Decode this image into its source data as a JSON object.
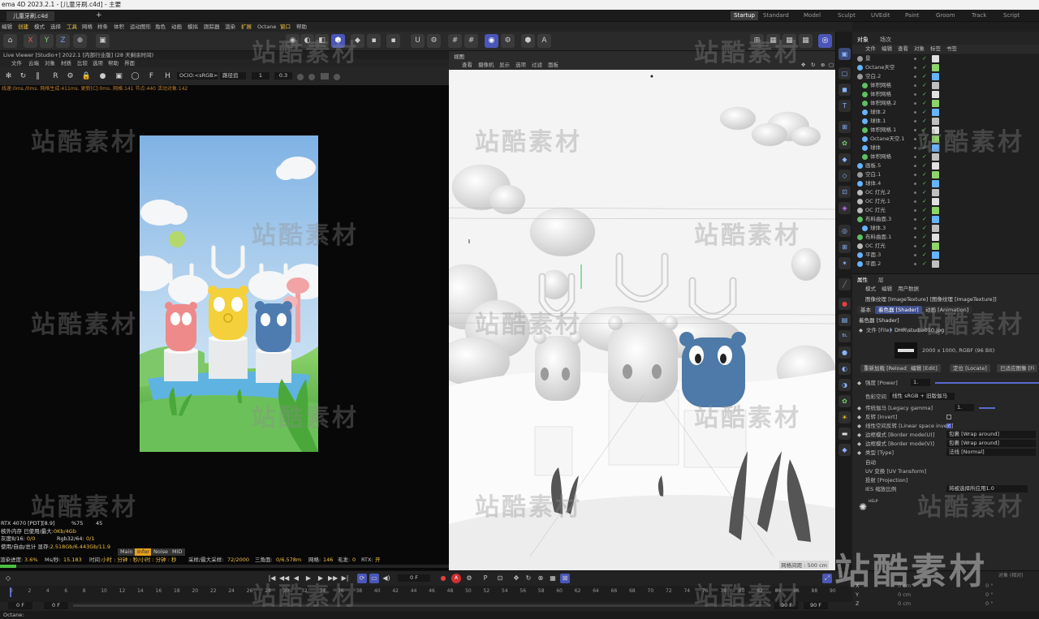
{
  "window": {
    "title": "ema 4D 2023.2.1 - [儿童牙刷.c4d] - 主要"
  },
  "doc_tab": "儿童牙刷.c4d",
  "layouts": [
    "Startup",
    "Standard",
    "Model",
    "Sculpt",
    "UVEdit",
    "Paint",
    "Groom",
    "Track",
    "Script"
  ],
  "menu": [
    "编辑",
    "创建",
    "模式",
    "选择",
    "工具",
    "网格",
    "样条",
    "体积",
    "运动图形",
    "角色",
    "动画",
    "模拟",
    "跟踪器",
    "渲染",
    "扩展",
    "Octane",
    "窗口",
    "帮助"
  ],
  "toolbar_axis": [
    "X",
    "Y",
    "Z"
  ],
  "live_viewer": {
    "title": "Live Viewer [Studio+] 2022.1 [内部行业版] (28 天剩余时间)",
    "menu": [
      "文件",
      "云端",
      "对象",
      "材质",
      "比较",
      "选项",
      "帮助",
      "界面"
    ],
    "ocio": "OCIO:<sRGB>",
    "mode": "路径追",
    "val1": "1",
    "val2": "0.3",
    "status": "线速:0ms./0ms. 网格生成:411ms. 更新[C]:0ms. 网格:141 节点:440 活动对象:142",
    "info": [
      {
        "a": "RTX 4070 [PDT][8.9]",
        "b": "%75",
        "c": "45"
      },
      {
        "a": "核外内存 已使用/最大:",
        "b": "0Kb/4Gb"
      },
      {
        "a": "灰度8/16:",
        "b": "0/0",
        "c": "Rgb32/64:",
        "d": "0/1"
      },
      {
        "a": "使用/自由/总计 显存:",
        "b": "2.518Gb/6.443Gb/11.9"
      }
    ],
    "tabs": [
      "Main",
      "Infor",
      "Noise",
      "MID"
    ],
    "bottom": {
      "progress_label": "渲染进度:",
      "progress": "3.6%",
      "ms_label": "Ms/秒:",
      "ms": "15.183",
      "time_label": "时间:",
      "time": "小时 : 分钟 : 秒/小时 : 分钟 : 秒",
      "spp_label": "采样/最大采样:",
      "spp": "72/2000",
      "tri_label": "三角面:",
      "tri": "0/6.578m",
      "mesh_label": "网格:",
      "mesh": "146",
      "hair_label": "毛发:",
      "hair": "0",
      "rtx_label": "RTX:",
      "rtx": "开"
    },
    "progress_fraction": 0.036
  },
  "viewport": {
    "title": "视图",
    "menu": [
      "查看",
      "摄像机",
      "显示",
      "选项",
      "过滤",
      "面板"
    ],
    "footer": "网格间距 : 500 cm"
  },
  "object_manager": {
    "tabs": [
      "对象",
      "场次"
    ],
    "menu": [
      "文件",
      "编辑",
      "查看",
      "对象",
      "标签",
      "书签"
    ],
    "rows": [
      {
        "name": "景",
        "icon": "null-icon",
        "color": "#9a9a9a",
        "indent": 0
      },
      {
        "name": "Octane天空",
        "icon": "sky-icon",
        "color": "#66b3ff",
        "indent": 0
      },
      {
        "name": "空白.2",
        "icon": "null-icon",
        "color": "#9a9a9a",
        "indent": 0
      },
      {
        "name": "体积网格",
        "icon": "volume-icon",
        "color": "#5fc060",
        "indent": 1
      },
      {
        "name": "体积网格",
        "icon": "volume-icon",
        "color": "#5fc060",
        "indent": 1
      },
      {
        "name": "体积网格.2",
        "icon": "volume-icon",
        "color": "#5fc060",
        "indent": 1
      },
      {
        "name": "球体.2",
        "icon": "sphere-icon",
        "color": "#66b3ff",
        "indent": 1
      },
      {
        "name": "球体.1",
        "icon": "sphere-icon",
        "color": "#66b3ff",
        "indent": 1
      },
      {
        "name": "体积网格.1",
        "icon": "volume-icon",
        "color": "#5fc060",
        "indent": 1
      },
      {
        "name": "Octane天空.1",
        "icon": "sky-icon",
        "color": "#66b3ff",
        "indent": 1
      },
      {
        "name": "球体",
        "icon": "sphere-icon",
        "color": "#66b3ff",
        "indent": 1
      },
      {
        "name": "体积网格",
        "icon": "volume-icon",
        "color": "#5fc060",
        "indent": 1
      },
      {
        "name": "画板.5",
        "icon": "plane-icon",
        "color": "#66b3ff",
        "indent": 0
      },
      {
        "name": "空白.1",
        "icon": "null-icon",
        "color": "#9a9a9a",
        "indent": 0
      },
      {
        "name": "球体.4",
        "icon": "sphere-icon",
        "color": "#66b3ff",
        "indent": 0
      },
      {
        "name": "OC 灯光.2",
        "icon": "light-icon",
        "color": "#bbbbbb",
        "indent": 0
      },
      {
        "name": "OC 灯光.1",
        "icon": "light-icon",
        "color": "#bbbbbb",
        "indent": 0
      },
      {
        "name": "OC 灯光",
        "icon": "light-icon",
        "color": "#bbbbbb",
        "indent": 0
      },
      {
        "name": "布料曲面.3",
        "icon": "cloth-icon",
        "color": "#5fc060",
        "indent": 0
      },
      {
        "name": "球体.3",
        "icon": "sphere-icon",
        "color": "#66b3ff",
        "indent": 1
      },
      {
        "name": "布料曲面.1",
        "icon": "cloth-icon",
        "color": "#5fc060",
        "indent": 0
      },
      {
        "name": "OC 灯光",
        "icon": "light-icon",
        "color": "#bbbbbb",
        "indent": 0
      },
      {
        "name": "平面.3",
        "icon": "plane-icon",
        "color": "#66b3ff",
        "indent": 0
      },
      {
        "name": "平面.2",
        "icon": "plane-icon",
        "color": "#66b3ff",
        "indent": 0
      }
    ]
  },
  "attributes": {
    "tabs": [
      "属性",
      "层"
    ],
    "menu": [
      "模式",
      "编辑",
      "用户数据"
    ],
    "header": "图像纹理 [ImageTexture] [图像纹理 [ImageTexture]]",
    "subtabs": [
      "基本",
      "着色器 [Shader]",
      "动画 [Animation]"
    ],
    "section": "着色器 [Shader]",
    "file_label": "文件 [File]",
    "file_value": "DHR\\studio010.jpg",
    "image_info": "2000 x 1000, RGBF (96 Bit)",
    "buttons": [
      "重新加载 [Reload]",
      "编辑 [Edit]",
      "定位 [Locate]",
      "已适应图像 [Fi"
    ],
    "power_label": "强度 [Power]",
    "power_value": "1.",
    "colorspace_label": "色彩空间",
    "colorspace_value": "线性 sRGB + 旧版伽马",
    "gamma_label": "传统伽马 [Legacy gamma]",
    "gamma_value": "1.",
    "invert_label": "反转 [Invert]",
    "linear_label": "线性空间反转 [Linear space invert]",
    "border_u_label": "边框模式 [Border mode(U)]",
    "border_u_value": "包裹 [Wrap around]",
    "border_v_label": "边框模式 [Border mode(V)]",
    "border_v_value": "包裹 [Wrap around]",
    "type_label": "类型 [Type]",
    "type_value": "法线 [Normal]",
    "extra": [
      "自动",
      "UV 变换 [UV Transform]",
      "投射 [Projection]",
      "IES 缩放比例"
    ],
    "ies_value": "将被选择所应用1.0",
    "logo": "HELP"
  },
  "timeline": {
    "frame": "0 F",
    "start": "0 F",
    "start2": "0 F",
    "end": "90 F",
    "end2": "90 F",
    "ticks": [
      "0",
      "2",
      "4",
      "6",
      "8",
      "10",
      "12",
      "14",
      "16",
      "18",
      "20",
      "22",
      "24",
      "26",
      "28",
      "30",
      "32",
      "34",
      "36",
      "38",
      "40",
      "42",
      "44",
      "46",
      "48",
      "50",
      "52",
      "54",
      "56",
      "58",
      "60",
      "62",
      "64",
      "66",
      "68",
      "70",
      "72",
      "74",
      "76",
      "78",
      "80",
      "82",
      "84",
      "86",
      "88",
      "90"
    ]
  },
  "coords": {
    "header": "对象 (相对)",
    "rows": [
      {
        "axis": "X",
        "pos": "0 cm",
        "rot": "0 °"
      },
      {
        "axis": "Y",
        "pos": "0 cm",
        "rot": "0 °"
      },
      {
        "axis": "Z",
        "pos": "0 cm",
        "rot": "0 °"
      }
    ]
  },
  "status": "Octane:",
  "watermark": "站酷素材"
}
